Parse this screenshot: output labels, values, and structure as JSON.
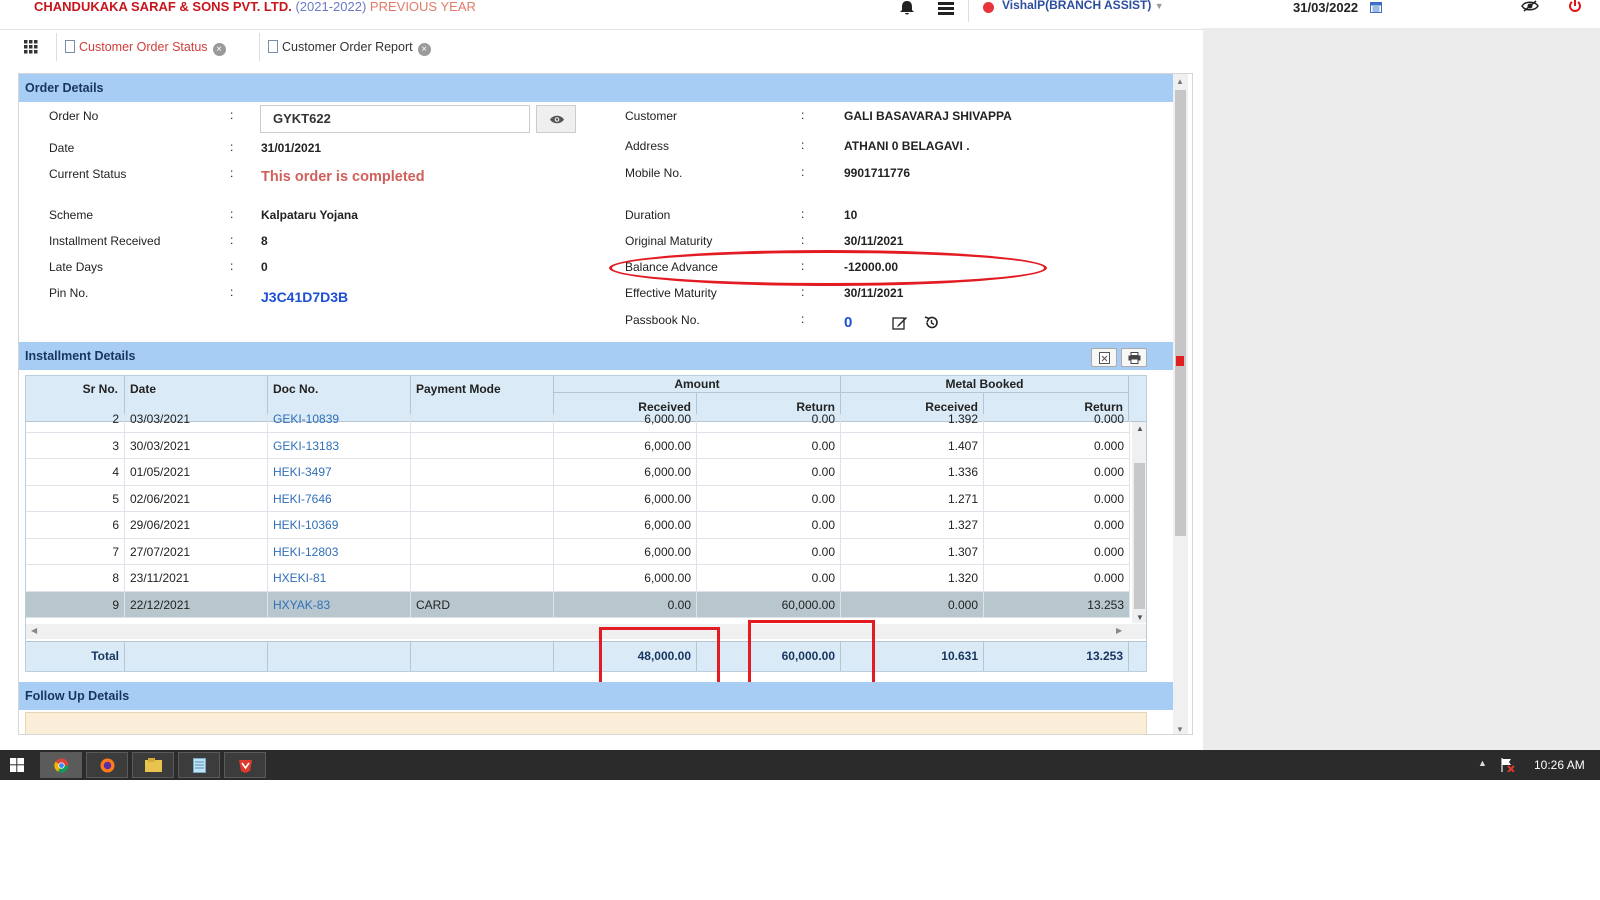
{
  "header": {
    "company": "CHANDUKAKA SARAF & SONS PVT. LTD.",
    "year": "(2021-2022)",
    "previous_year": "PREVIOUS YEAR",
    "user": "VishalP(BRANCH ASSIST)",
    "current_date": "31/03/2022"
  },
  "tabs": [
    {
      "label": "Customer Order Status",
      "active": true
    },
    {
      "label": "Customer Order Report",
      "active": false
    }
  ],
  "order_details": {
    "title": "Order Details",
    "order_no_label": "Order No",
    "order_no_value": "GYKT622",
    "date_label": "Date",
    "date_value": "31/01/2021",
    "status_label": "Current Status",
    "status_value": "This order is completed",
    "scheme_label": "Scheme",
    "scheme_value": "Kalpataru Yojana",
    "installment_received_label": "Installment Received",
    "installment_received_value": "8",
    "late_days_label": "Late Days",
    "late_days_value": "0",
    "pin_label": "Pin No.",
    "pin_value": "J3C41D7D3B",
    "customer_label": "Customer",
    "customer_value": "GALI BASAVARAJ SHIVAPPA",
    "address_label": "Address",
    "address_value": "ATHANI 0 BELAGAVI .",
    "mobile_label": "Mobile No.",
    "mobile_value": "9901711776",
    "duration_label": "Duration",
    "duration_value": "10",
    "original_maturity_label": "Original Maturity",
    "original_maturity_value": "30/11/2021",
    "balance_advance_label": "Balance Advance",
    "balance_advance_value": "-12000.00",
    "effective_maturity_label": "Effective Maturity",
    "effective_maturity_value": "30/11/2021",
    "passbook_label": "Passbook No.",
    "passbook_value": "0",
    "colon": ":"
  },
  "installments": {
    "title": "Installment Details",
    "columns": {
      "sr_no": "Sr No.",
      "date": "Date",
      "doc_no": "Doc No.",
      "payment_mode": "Payment Mode",
      "amount": "Amount",
      "metal_booked": "Metal Booked",
      "received": "Received",
      "return": "Return"
    },
    "rows": [
      {
        "sr": "2",
        "date": "03/03/2021",
        "doc": "GEKI-10839",
        "mode": "",
        "amt_rec": "6,000.00",
        "amt_ret": "0.00",
        "met_rec": "1.392",
        "met_ret": "0.000"
      },
      {
        "sr": "3",
        "date": "30/03/2021",
        "doc": "GEKI-13183",
        "mode": "",
        "amt_rec": "6,000.00",
        "amt_ret": "0.00",
        "met_rec": "1.407",
        "met_ret": "0.000"
      },
      {
        "sr": "4",
        "date": "01/05/2021",
        "doc": "HEKI-3497",
        "mode": "",
        "amt_rec": "6,000.00",
        "amt_ret": "0.00",
        "met_rec": "1.336",
        "met_ret": "0.000"
      },
      {
        "sr": "5",
        "date": "02/06/2021",
        "doc": "HEKI-7646",
        "mode": "",
        "amt_rec": "6,000.00",
        "amt_ret": "0.00",
        "met_rec": "1.271",
        "met_ret": "0.000"
      },
      {
        "sr": "6",
        "date": "29/06/2021",
        "doc": "HEKI-10369",
        "mode": "",
        "amt_rec": "6,000.00",
        "amt_ret": "0.00",
        "met_rec": "1.327",
        "met_ret": "0.000"
      },
      {
        "sr": "7",
        "date": "27/07/2021",
        "doc": "HEKI-12803",
        "mode": "",
        "amt_rec": "6,000.00",
        "amt_ret": "0.00",
        "met_rec": "1.307",
        "met_ret": "0.000"
      },
      {
        "sr": "8",
        "date": "23/11/2021",
        "doc": "HXEKI-81",
        "mode": "",
        "amt_rec": "6,000.00",
        "amt_ret": "0.00",
        "met_rec": "1.320",
        "met_ret": "0.000"
      },
      {
        "sr": "9",
        "date": "22/12/2021",
        "doc": "HXYAK-83",
        "mode": "CARD",
        "amt_rec": "0.00",
        "amt_ret": "60,000.00",
        "met_rec": "0.000",
        "met_ret": "13.253"
      }
    ],
    "total": {
      "label": "Total",
      "amt_rec": "48,000.00",
      "amt_ret": "60,000.00",
      "met_rec": "10.631",
      "met_ret": "13.253"
    }
  },
  "follow_up": {
    "title": "Follow Up Details"
  },
  "taskbar": {
    "time": "10:26 AM"
  },
  "colors": {
    "brand_red": "#c8161d",
    "section_header": "#a8cdf5",
    "annotation_red": "#e31b23",
    "link_blue": "#2f6fb7"
  }
}
